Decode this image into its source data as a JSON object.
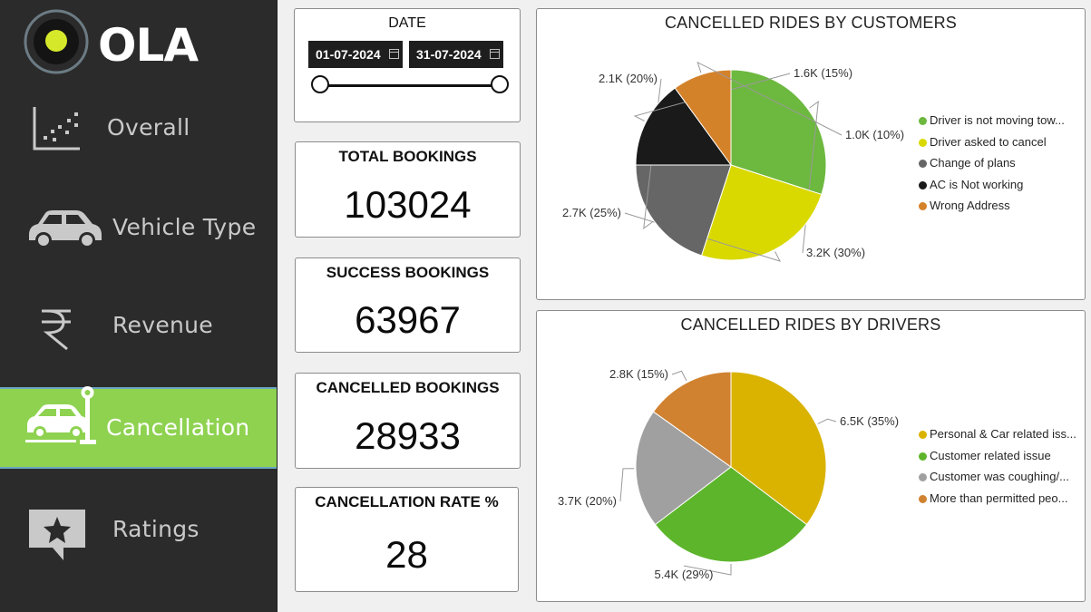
{
  "sidebar": {
    "logo_text": "OLA",
    "items": [
      {
        "label": "Overall",
        "icon": "scatter-chart-icon",
        "active": false
      },
      {
        "label": "Vehicle Type",
        "icon": "car-icon",
        "active": false
      },
      {
        "label": "Revenue",
        "icon": "rupee-icon",
        "active": false
      },
      {
        "label": "Cancellation",
        "icon": "car-crash-icon",
        "active": true
      },
      {
        "label": "Ratings",
        "icon": "star-chat-icon",
        "active": false
      }
    ],
    "active_color": "#8ed250"
  },
  "date_filter": {
    "title": "DATE",
    "start": "01-07-2024",
    "end": "31-07-2024",
    "slider_start_fraction": 0,
    "slider_end_fraction": 1
  },
  "kpis": [
    {
      "title": "TOTAL BOOKINGS",
      "value": "103024"
    },
    {
      "title": "SUCCESS BOOKINGS",
      "value": "63967"
    },
    {
      "title": "CANCELLED BOOKINGS",
      "value": "28933"
    },
    {
      "title": "CANCELLATION RATE %",
      "value": "28"
    }
  ],
  "chart_data": [
    {
      "type": "pie",
      "title": "CANCELLED RIDES BY CUSTOMERS",
      "legend_position": "right",
      "slices": [
        {
          "name": "Driver is not moving tow...",
          "value": 30,
          "label": "3.2K (30%)",
          "color": "#6db83f"
        },
        {
          "name": "Driver asked to cancel",
          "value": 25,
          "label": "2.7K (25%)",
          "color": "#d9d900"
        },
        {
          "name": "Change of plans",
          "value": 20,
          "label": "2.1K (20%)",
          "color": "#666666"
        },
        {
          "name": "AC is Not working",
          "value": 15,
          "label": "1.6K (15%)",
          "color": "#1a1a1a"
        },
        {
          "name": "Wrong Address",
          "value": 10,
          "label": "1.0K (10%)",
          "color": "#d4822a"
        }
      ]
    },
    {
      "type": "pie",
      "title": "CANCELLED RIDES BY DRIVERS",
      "legend_position": "right",
      "slices": [
        {
          "name": "Personal & Car related iss...",
          "value": 35,
          "label": "6.5K (35%)",
          "color": "#d9b300"
        },
        {
          "name": "Customer related issue",
          "value": 29,
          "label": "5.4K (29%)",
          "color": "#5db52b"
        },
        {
          "name": "Customer was coughing/...",
          "value": 20,
          "label": "3.7K (20%)",
          "color": "#a0a0a0"
        },
        {
          "name": "More than permitted peo...",
          "value": 15,
          "label": "2.8K (15%)",
          "color": "#d08230"
        }
      ]
    }
  ]
}
